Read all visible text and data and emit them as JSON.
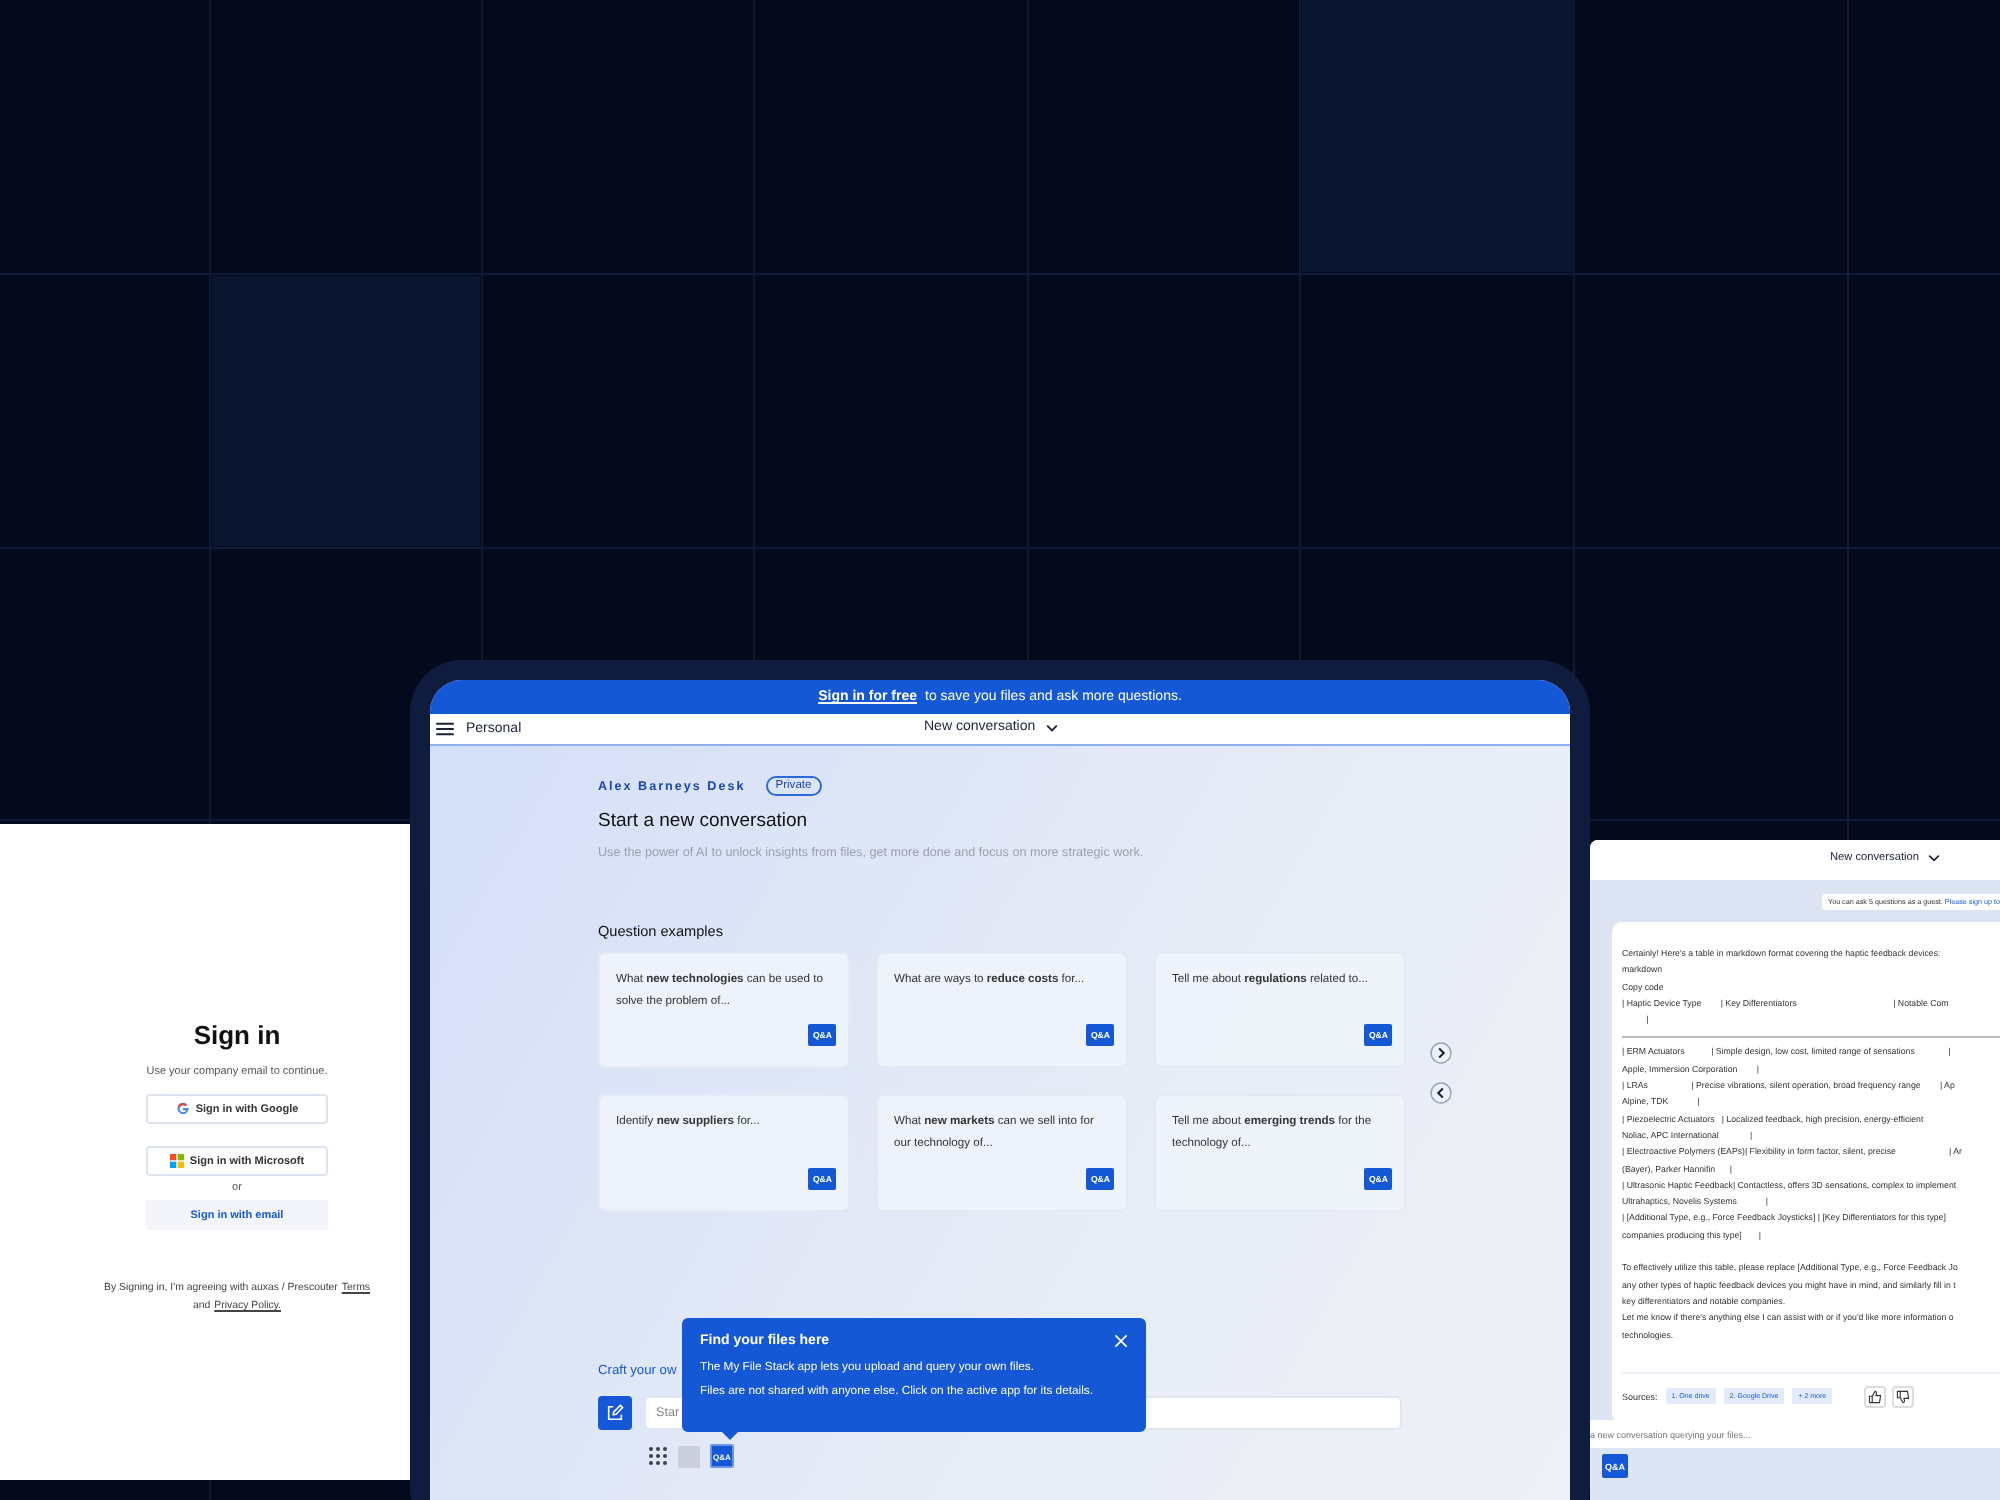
{
  "signin": {
    "title": "Sign in",
    "subtitle": "Use your company email to continue.",
    "buttons": [
      {
        "kind": "google",
        "label": "Sign in with Google"
      },
      {
        "kind": "microsoft",
        "label": "Sign in with Microsoft"
      }
    ],
    "or": "or",
    "email_button": "Sign in with email",
    "legal": "By Signing in, I'm agreeing with auxas / Prescouter",
    "terms": "Terms",
    "and": "and",
    "privacy": "Privacy Policy."
  },
  "main": {
    "banner_link": "Sign in for free",
    "banner_text": "to save you files and ask more questions.",
    "workspace": "Personal",
    "conversation": "New conversation",
    "desk": "Alex Barneys Desk",
    "badge": "Private",
    "title": "Start a new conversation",
    "subtitle": "Use the power of AI to unlock insights from files, get more done and focus on more strategic work.",
    "examples_title": "Question examples",
    "examples": [
      {
        "text": "What **new technologies** can be used to solve the problem of...",
        "tag": "Q&A"
      },
      {
        "text": "What are ways to **reduce costs** for...",
        "tag": "Q&A"
      },
      {
        "text": "Tell me about **regulations** related to...",
        "tag": "Q&A"
      },
      {
        "text": "Identify **new suppliers** for...",
        "tag": "Q&A"
      },
      {
        "text": "What **new markets** can we sell into for our technology of...",
        "tag": "Q&A"
      },
      {
        "text": "Tell me about **emerging trends** for the technology of...",
        "tag": "Q&A"
      }
    ],
    "craft": "Craft your ow",
    "input_value": "Star",
    "apps": [
      {
        "kind": "grid",
        "selected": false
      },
      {
        "kind": "files",
        "selected": false
      },
      {
        "kind": "qa",
        "label": "Q&A",
        "selected": true
      }
    ],
    "tooltip": {
      "title": "Find your files here",
      "lines": [
        "The My File Stack app lets you upload and query your own files.",
        "Files are not shared with anyone else.  Click on the active app for its details."
      ]
    }
  },
  "chat": {
    "conversation": "New conversation",
    "notice": "You can ask 5 questions as a guest.",
    "notice_link": "Please sign up to",
    "lines": [
      "Certainly! Here's a table in markdown format covering the haptic feedback devices:",
      "markdown",
      "Copy code",
      "| Haptic Device Type        | Key Differentiators                                        | Notable Com",
      "          |",
      "| ERM Actuators           | Simple design, low cost, limited range of sensations              |",
      "Apple, Immersion Corporation        |",
      "| LRAs                  | Precise vibrations, silent operation, broad frequency range        | Ap",
      "Alpine, TDK            |",
      "| Piezoelectric Actuators   | Localized feedback, high precision, energy-efficient",
      "Noliac, APC International             |",
      "| Electroactive Polymers (EAPs)| Flexibility in form factor, silent, precise                      | Ar",
      "(Bayer), Parker Hannifin      |",
      "| Ultrasonic Haptic Feedback| Contactless, offers 3D sensations, complex to implement",
      "Ultrahaptics, Novelis Systems            |",
      "| [Additional Type, e.g., Force Feedback Joysticks] | [Key Differentiators for this type]",
      "companies producing this type]       |"
    ],
    "note_lines": [
      "To effectively utilize this table, please replace [Additional Type, e.g., Force Feedback Jo",
      "any other types of haptic feedback devices you might have in mind, and similarly fill in t",
      "key differentiators and notable companies.",
      "Let me know if there's anything else I can assist with or if you'd like more information o",
      "technologies."
    ],
    "sources_label": "Sources:",
    "sources": [
      "1. One drive",
      "2. Google Drive",
      "+ 2 more"
    ],
    "input_placeholder": "a new conversation querying your files...",
    "app": "Q&A"
  }
}
